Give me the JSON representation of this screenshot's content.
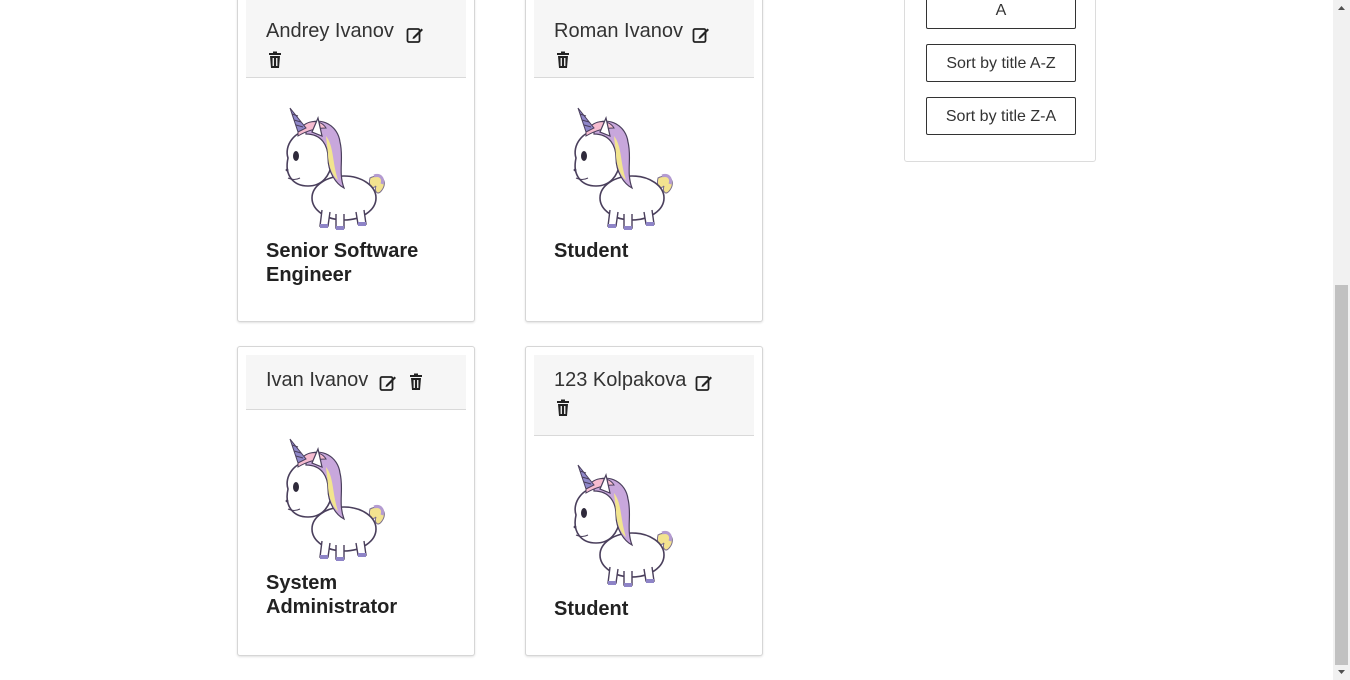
{
  "cards": [
    {
      "name": "Andrey Ivanov",
      "role": "Senior Software Engineer"
    },
    {
      "name": "Roman Ivanov",
      "role": "Student"
    },
    {
      "name": "Ivan Ivanov",
      "role": "System Administrator"
    },
    {
      "name": "123 Kolpakova",
      "role": "Student"
    }
  ],
  "sort": {
    "partial_label": "A",
    "title_az": "Sort by title A-Z",
    "title_za": "Sort by title Z-A"
  },
  "icons": {
    "edit": "edit-icon",
    "delete": "trash-icon",
    "avatar": "unicorn-avatar"
  }
}
